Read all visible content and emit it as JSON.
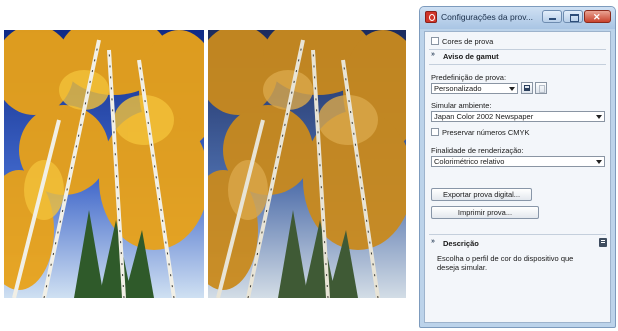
{
  "window": {
    "title": "Configurações da prov..."
  },
  "options": {
    "proof_colors_label": "Cores de prova"
  },
  "gamut_section": {
    "title": "Aviso de gamut"
  },
  "preset": {
    "label": "Predefinição de prova:",
    "value": "Personalizado"
  },
  "simulate": {
    "label": "Simular ambiente:",
    "value": "Japan Color 2002 Newspaper"
  },
  "preserve_cmyk": {
    "label": "Preservar números CMYK"
  },
  "rendering": {
    "label": "Finalidade de renderização:",
    "value": "Colorimétrico relativo"
  },
  "actions": {
    "export_label": "Exportar prova digital...",
    "print_label": "Imprimir prova..."
  },
  "description": {
    "title": "Descrição",
    "text": "Escolha o perfil de cor do dispositivo que deseja simular."
  },
  "colors": {
    "left_sky": "#17308a",
    "right_sky": "#1d2e63",
    "left_foliage": "#e8a21a",
    "right_foliage": "#c98a1e"
  }
}
